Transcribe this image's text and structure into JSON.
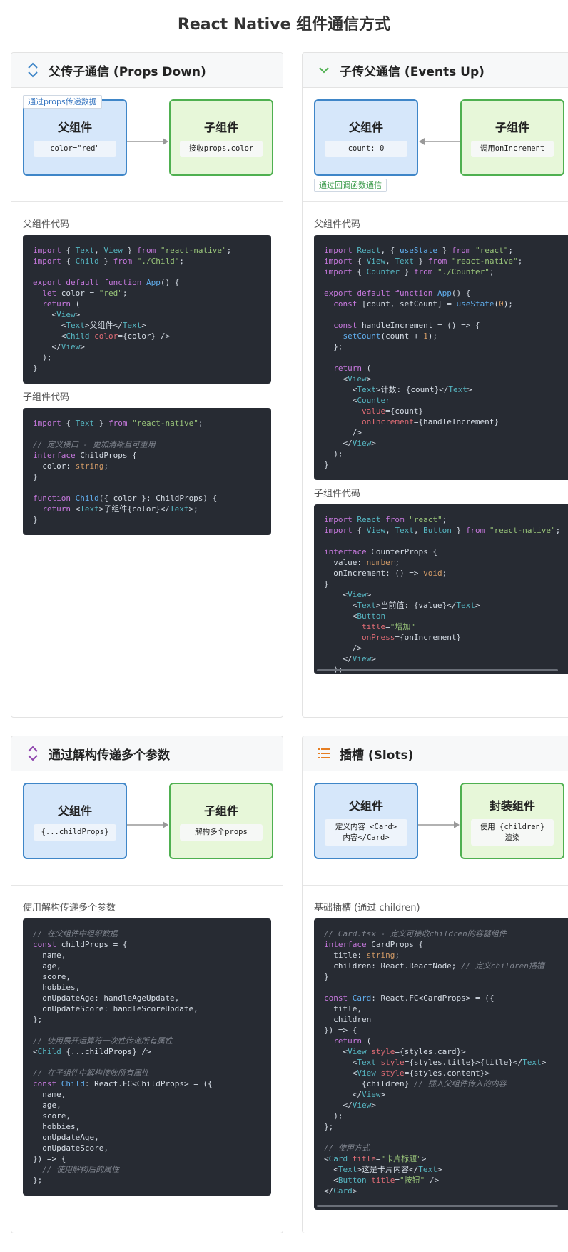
{
  "page": {
    "title": "React Native 组件通信方式"
  },
  "cards": [
    {
      "title": "父传子通信 (Props Down)",
      "icon": "chevron-updown-icon",
      "diagram": {
        "parent_title": "父组件",
        "parent_sub": "color=\"red\"",
        "child_title": "子组件",
        "child_sub": "接收props.color",
        "tag": "通过props传递数据",
        "direction": "right"
      },
      "sections": [
        {
          "label": "父组件代码"
        },
        {
          "label": "子组件代码"
        }
      ]
    },
    {
      "title": "子传父通信 (Events Up)",
      "icon": "chevron-down-icon",
      "diagram": {
        "parent_title": "父组件",
        "parent_sub": "count: 0",
        "child_title": "子组件",
        "child_sub": "调用onIncrement",
        "tag": "通过回调函数通信",
        "direction": "left"
      },
      "sections": [
        {
          "label": "父组件代码"
        },
        {
          "label": "子组件代码"
        }
      ]
    },
    {
      "title": "通过解构传递多个参数",
      "icon": "chevron-updown-icon",
      "diagram": {
        "parent_title": "父组件",
        "parent_sub": "{...childProps}",
        "child_title": "子组件",
        "child_sub": "解构多个props",
        "direction": "right"
      },
      "sections": [
        {
          "label": "使用解构传递多个参数"
        }
      ]
    },
    {
      "title": "插槽 (Slots)",
      "icon": "list-icon",
      "diagram": {
        "parent_title": "父组件",
        "parent_sub": "定义内容 <Card>内容</Card>",
        "child_title": "封装组件",
        "child_sub": "使用 {children} 渲染",
        "direction": "right"
      },
      "sections": [
        {
          "label": "基础插槽 (通过 children)"
        }
      ]
    }
  ],
  "colors": {
    "accent_blue": "#3f86c8",
    "accent_green": "#4fb050",
    "accent_purple": "#8e44ad",
    "accent_orange": "#e67e22",
    "code_bg": "#272b33"
  }
}
